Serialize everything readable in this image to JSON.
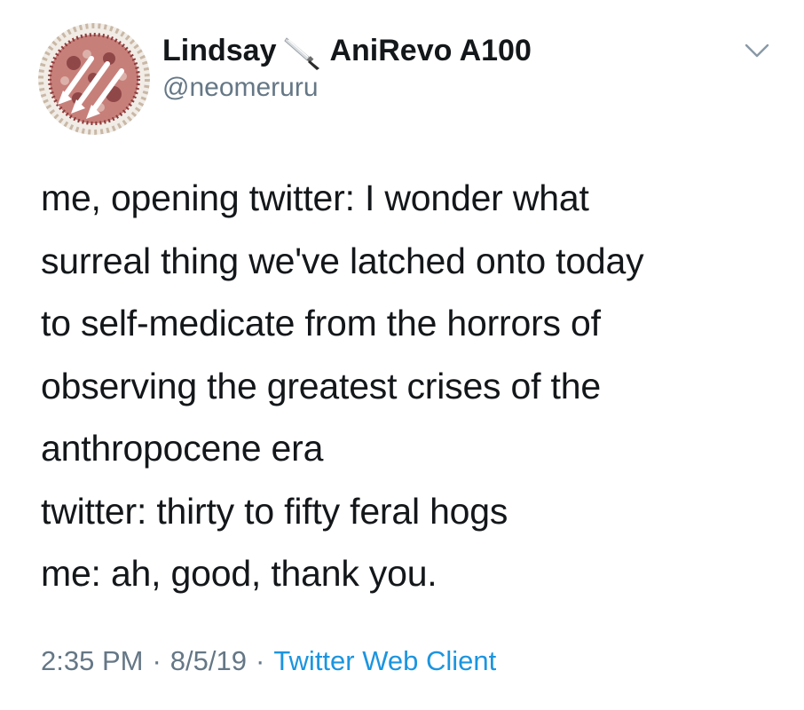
{
  "tweet": {
    "author": {
      "name": "Lindsay",
      "name_emoji": "knife-icon",
      "name_suffix": "AniRevo A100",
      "handle": "@neomeruru",
      "avatar": "avatar-image"
    },
    "menu_icon": "chevron-down-icon",
    "text_lines": [
      "me, opening twitter: I wonder what",
      "surreal thing we've latched onto today",
      "to self-medicate from the horrors of",
      "observing the greatest crises of the",
      "anthropocene era",
      "twitter: thirty to fifty feral hogs",
      "me: ah, good, thank you."
    ],
    "time": "2:35 PM",
    "date": "8/5/19",
    "separator": "·",
    "source": "Twitter Web Client"
  },
  "colors": {
    "text": "#14171a",
    "secondary": "#657786",
    "link": "#1b95e0",
    "background": "#ffffff"
  }
}
